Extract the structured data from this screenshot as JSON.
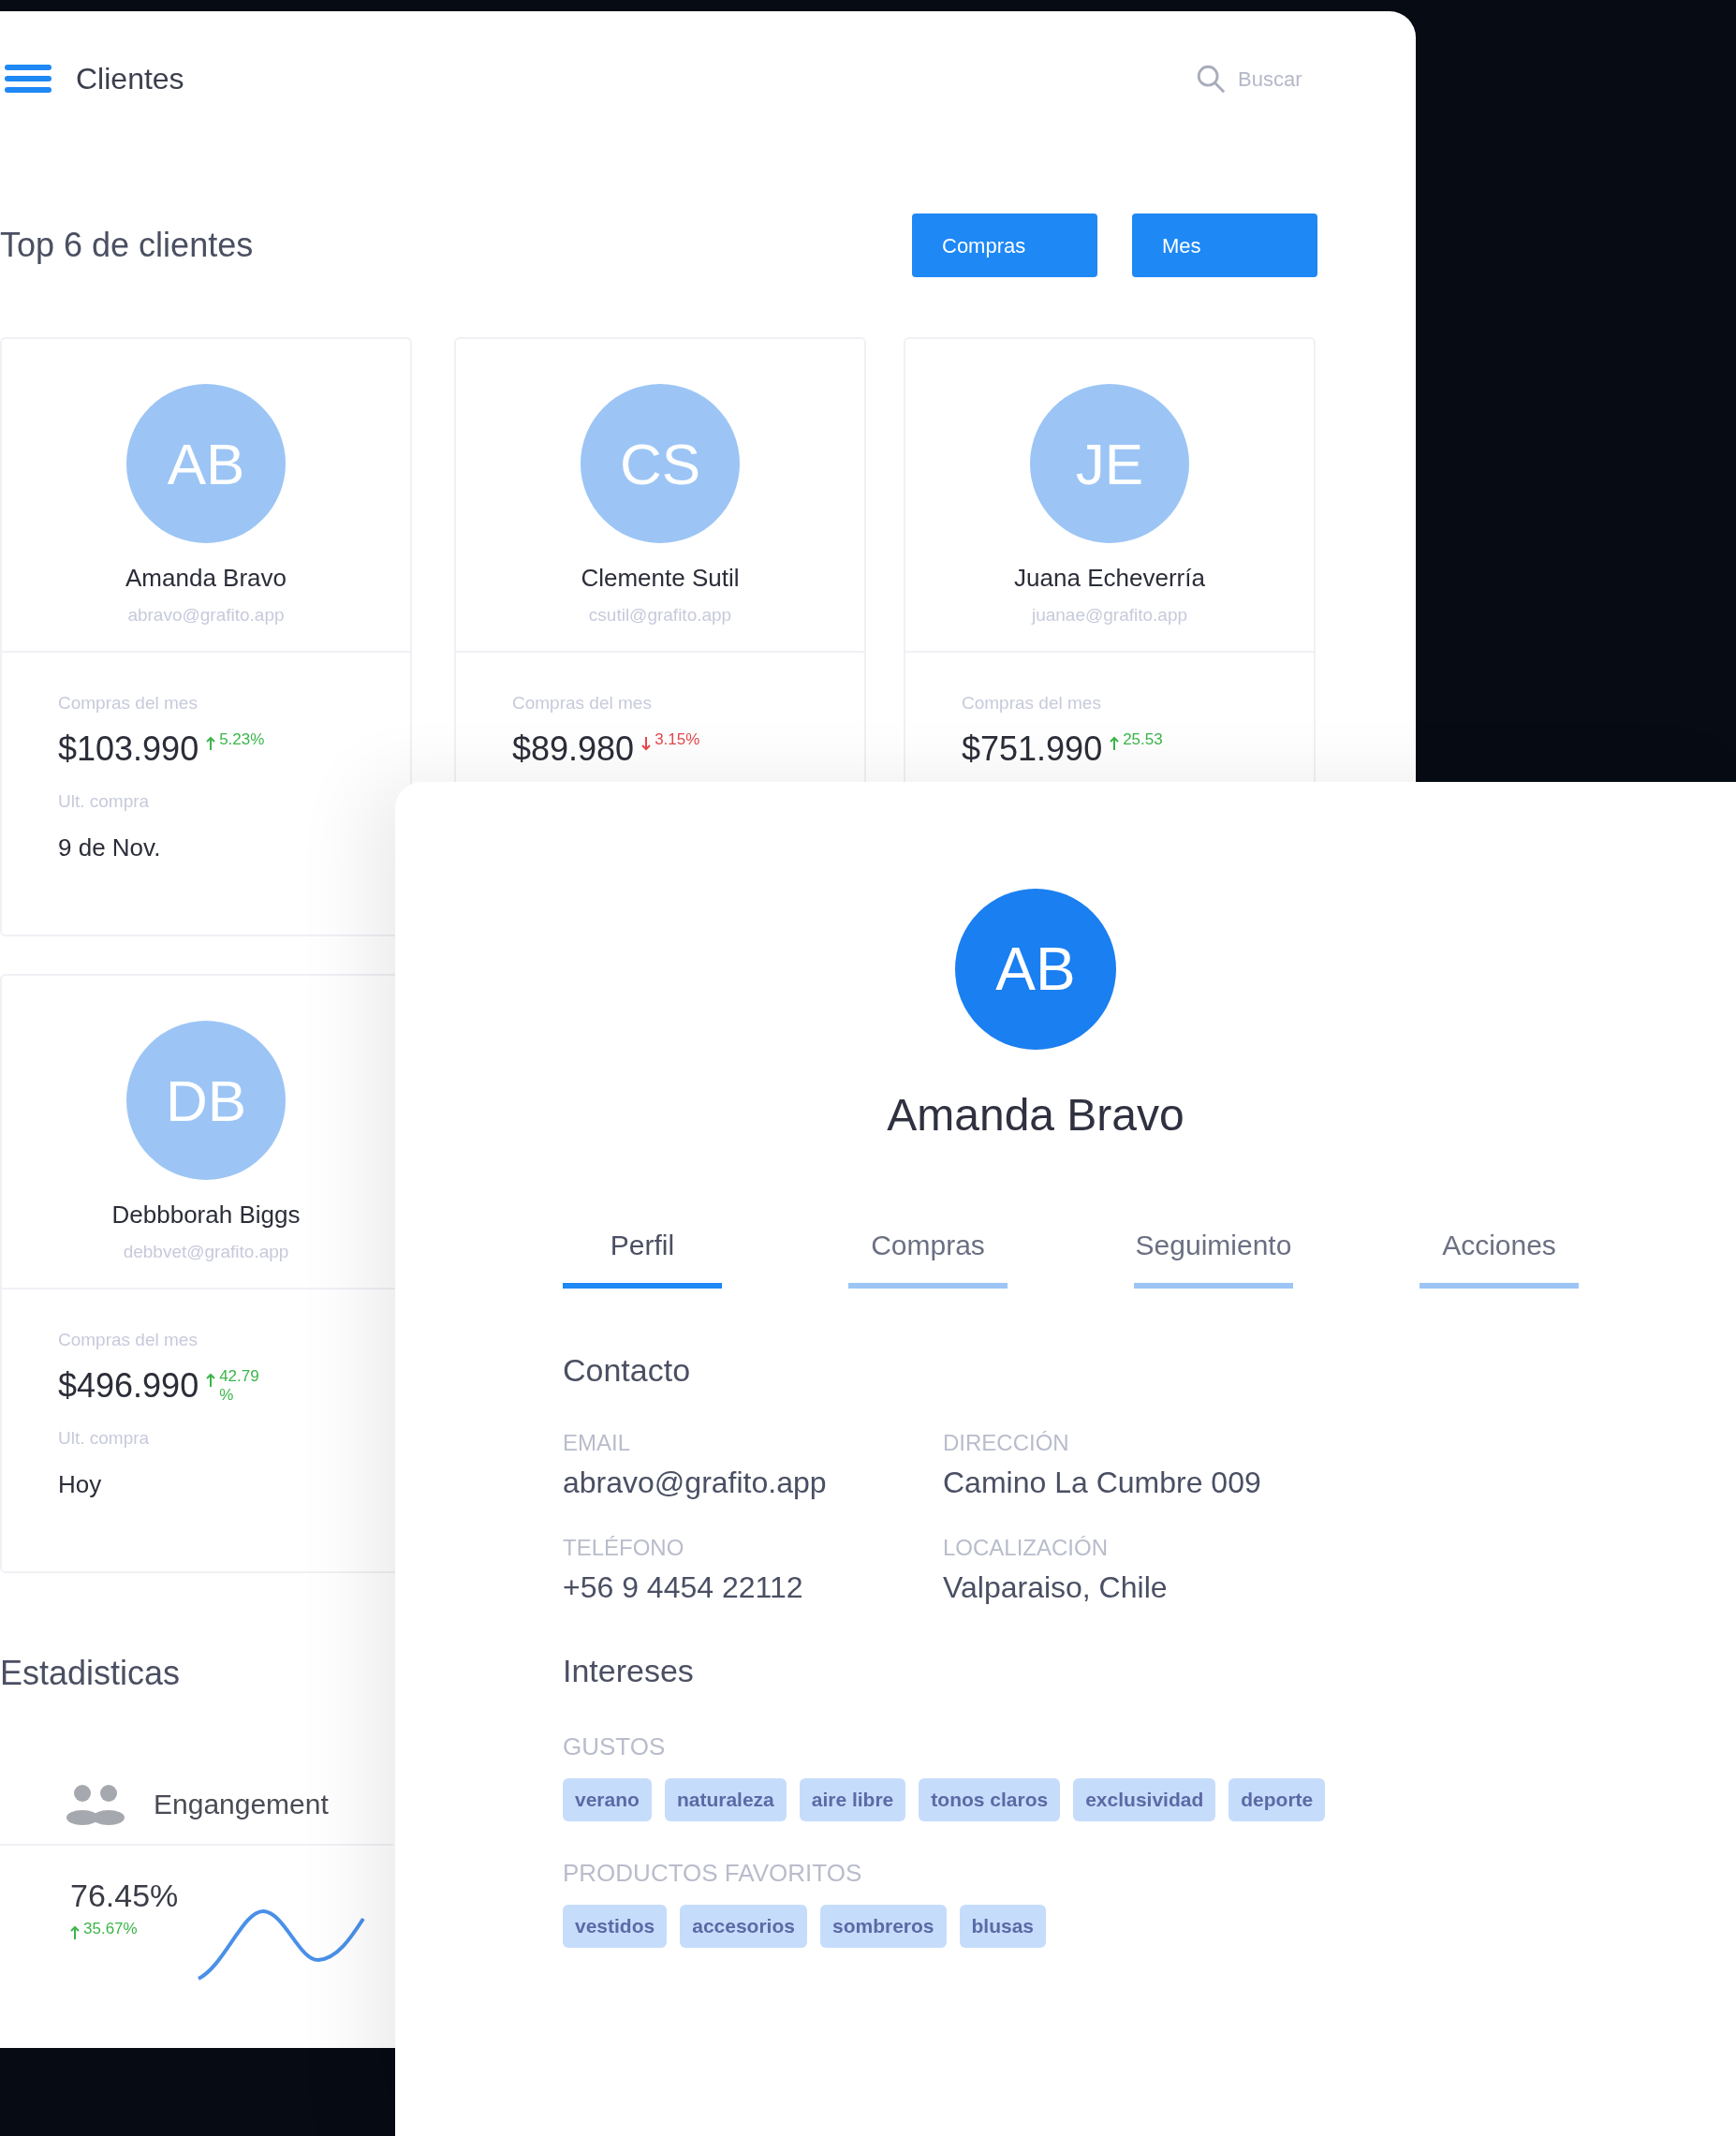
{
  "header": {
    "title": "Clientes",
    "search": {
      "placeholder": "Buscar"
    }
  },
  "top_clients": {
    "title": "Top 6 de clientes",
    "filters": [
      "Compras",
      "Mes"
    ],
    "cards": [
      {
        "initials": "AB",
        "name": "Amanda Bravo",
        "email": "abravo@grafito.app",
        "purchases_label": "Compras del mes",
        "amount": "$103.990",
        "change": "5.23%",
        "rising": true,
        "last_purchase_label": "Ult. compra",
        "last_purchase": "9 de Nov."
      },
      {
        "initials": "CS",
        "name": "Clemente Sutil",
        "email": "csutil@grafito.app",
        "purchases_label": "Compras del mes",
        "amount": "$89.980",
        "change": "3.15%",
        "rising": false
      },
      {
        "initials": "JE",
        "name": "Juana Echeverría",
        "email": "juanae@grafito.app",
        "purchases_label": "Compras del mes",
        "amount": "$751.990",
        "change": "25.53",
        "rising": true
      },
      {
        "initials": "DB",
        "name": "Debbborah Biggs",
        "email": "debbvet@grafito.app",
        "purchases_label": "Compras del mes",
        "amount": "$496.990",
        "change": "42.79 %",
        "rising": true,
        "last_purchase_label": "Ult. compra",
        "last_purchase": "Hoy"
      }
    ]
  },
  "stats": {
    "title": "Estadisticas",
    "metric": {
      "label": "Engangement",
      "value": "76.45%",
      "change": "35.67%",
      "rising": true
    }
  },
  "profile": {
    "initials": "AB",
    "name": "Amanda Bravo",
    "tabs": [
      {
        "label": "Perfil",
        "selected": true
      },
      {
        "label": "Compras",
        "selected": false
      },
      {
        "label": "Seguimiento",
        "selected": false
      },
      {
        "label": "Acciones",
        "selected": false
      }
    ],
    "contact": {
      "title": "Contacto",
      "fields": [
        {
          "label": "EMAIL",
          "value": "abravo@grafito.app"
        },
        {
          "label": "DIRECCIÓN",
          "value": "Camino La Cumbre 009"
        },
        {
          "label": "TELÉFONO",
          "value": "+56 9 4454 22112"
        },
        {
          "label": "LOCALIZACIÓN",
          "value": "Valparaiso, Chile"
        }
      ]
    },
    "interests": {
      "title": "Intereses",
      "groups": [
        {
          "label": "GUSTOS",
          "tags": [
            "verano",
            "naturaleza",
            "aire libre",
            "tonos claros",
            "exclusividad",
            "deporte"
          ]
        },
        {
          "label": "PRODUCTOS FAVORITOS",
          "tags": [
            "vestidos",
            "accesorios",
            "sombreros",
            "blusas"
          ]
        }
      ]
    }
  }
}
